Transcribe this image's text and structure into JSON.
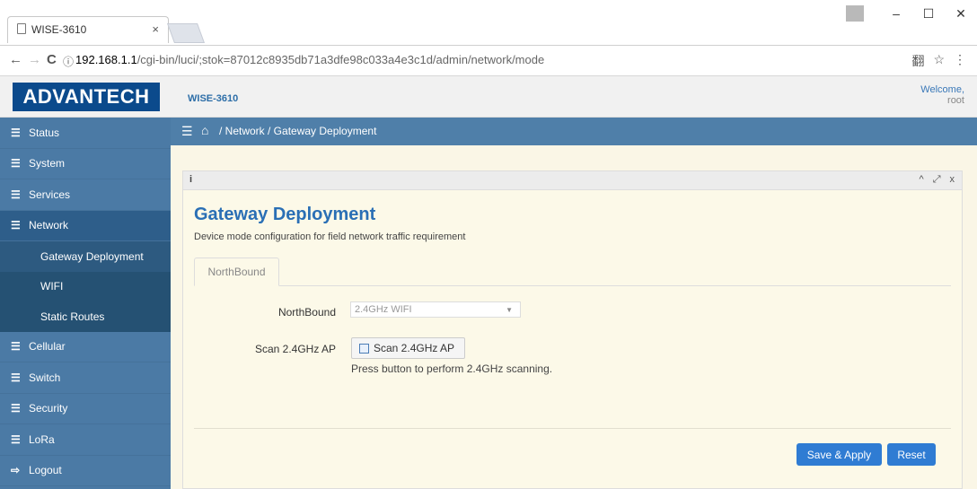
{
  "browser": {
    "tab_title": "WISE-3610",
    "tab_close": "×",
    "url_host": "192.168.1.1",
    "url_path": "/cgi-bin/luci/;stok=87012c8935db71a3dfe98c033a4e3c1d/admin/network/mode",
    "back": "←",
    "forward": "→",
    "reload": "C",
    "info_glyph": "ⓘ",
    "minimize": "–",
    "maximize": "☐",
    "close": "✕",
    "translate_glyph": "翻",
    "star_glyph": "☆",
    "menu_glyph": "⋮"
  },
  "header": {
    "logo_text": "ADVANTECH",
    "app_name": "WISE-3610",
    "welcome": "Welcome,",
    "user": "root"
  },
  "sidebar": {
    "bars_glyph": "☰",
    "items": [
      {
        "label": "Status"
      },
      {
        "label": "System"
      },
      {
        "label": "Services"
      },
      {
        "label": "Network"
      },
      {
        "label": "Gateway Deployment"
      },
      {
        "label": "WIFI"
      },
      {
        "label": "Static Routes"
      },
      {
        "label": "Cellular"
      },
      {
        "label": "Switch"
      },
      {
        "label": "Security"
      },
      {
        "label": "LoRa"
      },
      {
        "label": "Logout"
      }
    ],
    "logout_glyph": "⇨"
  },
  "breadcrumb": {
    "menu_glyph": "☰",
    "home_glyph": "⌂",
    "text": " / Network /  Gateway Deployment"
  },
  "widget": {
    "info_glyph": "i",
    "ctrl_up": "^",
    "ctrl_expand": "⤢",
    "ctrl_close": "x"
  },
  "page": {
    "title": "Gateway Deployment",
    "description": "Device mode configuration for field network traffic requirement",
    "tab": "NorthBound",
    "northbound_label": "NorthBound",
    "northbound_value": "2.4GHz WIFI",
    "caret": "▼",
    "scan_label": "Scan 2.4GHz AP",
    "scan_button": "Scan 2.4GHz AP",
    "scan_hint": "Press button to perform 2.4GHz scanning.",
    "save_apply": "Save & Apply",
    "reset": "Reset"
  },
  "colors": {
    "sidebar": "#4b7aa5",
    "sidebar_sub": "#255173",
    "content_bar": "#4f7fa9",
    "logo": "#0b4a8c",
    "title": "#2a6fb5",
    "primary_button": "#2f7cd3",
    "content_bg": "#faf6e6"
  }
}
